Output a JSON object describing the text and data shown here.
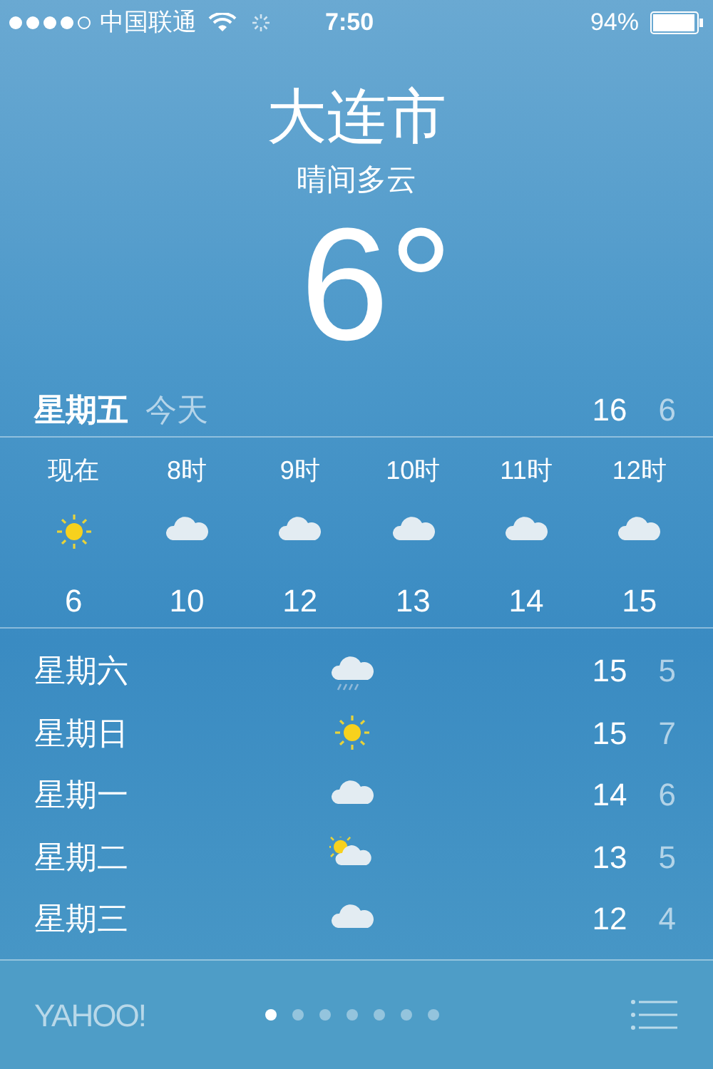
{
  "status_bar": {
    "carrier": "中国联通",
    "time": "7:50",
    "battery": "94%"
  },
  "city": "大连市",
  "condition": "晴间多云",
  "temperature": "6°",
  "today": {
    "day": "星期五",
    "label": "今天",
    "high": "16",
    "low": "6"
  },
  "hourly": [
    {
      "time": "现在",
      "kind": "sun",
      "temp": "6"
    },
    {
      "time": "8时",
      "kind": "cloud",
      "temp": "10"
    },
    {
      "time": "9时",
      "kind": "cloud",
      "temp": "12"
    },
    {
      "time": "10时",
      "kind": "cloud",
      "temp": "13"
    },
    {
      "time": "11时",
      "kind": "cloud",
      "temp": "14"
    },
    {
      "time": "12时",
      "kind": "cloud",
      "temp": "15"
    }
  ],
  "daily": [
    {
      "day": "星期六",
      "kind": "rain",
      "high": "15",
      "low": "5"
    },
    {
      "day": "星期日",
      "kind": "sun",
      "high": "15",
      "low": "7"
    },
    {
      "day": "星期一",
      "kind": "cloud",
      "high": "14",
      "low": "6"
    },
    {
      "day": "星期二",
      "kind": "partly",
      "high": "13",
      "low": "5"
    },
    {
      "day": "星期三",
      "kind": "cloud",
      "high": "12",
      "low": "4"
    }
  ],
  "footer": {
    "logo": "YAHOO!",
    "pages": [
      {
        "selected": true
      },
      {
        "selected": false
      },
      {
        "selected": false
      },
      {
        "selected": false
      },
      {
        "selected": false
      },
      {
        "selected": false
      },
      {
        "selected": false
      }
    ]
  }
}
